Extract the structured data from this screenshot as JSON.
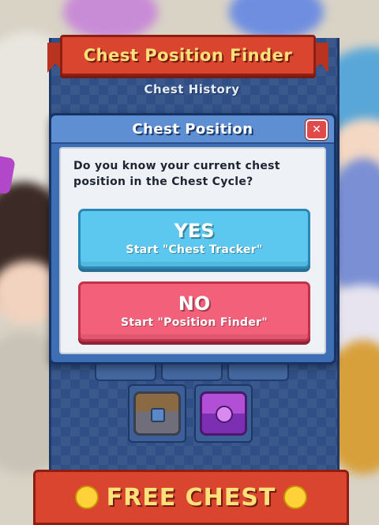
{
  "header": {
    "title": "Chest Position Finder"
  },
  "history": {
    "label": "Chest History"
  },
  "modal": {
    "title": "Chest Position",
    "close_symbol": "✕",
    "question": "Do you know your current chest position in the Chest Cycle?",
    "yes_button": {
      "main": "YES",
      "sub": "Start \"Chest Tracker\""
    },
    "no_button": {
      "main": "NO",
      "sub": "Start \"Position Finder\""
    }
  },
  "chests": [
    {
      "type": "wooden-chest-icon"
    },
    {
      "type": "magical-chest-icon"
    }
  ],
  "footer": {
    "label": "FREE CHEST"
  },
  "colors": {
    "ribbon": "#d9452e",
    "panel": "#2f4f86",
    "yes": "#5cc8ef",
    "no": "#f3607a",
    "gold_text": "#ffe07a"
  }
}
